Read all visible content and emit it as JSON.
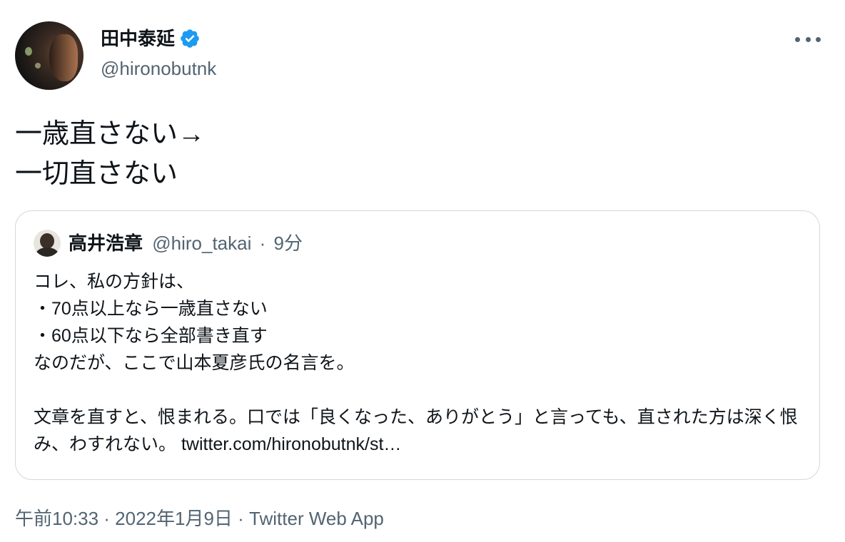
{
  "author": {
    "name": "田中泰延",
    "handle": "@hironobutnk",
    "verified_icon": "verified-badge-icon",
    "accent_color": "#1d9bf0"
  },
  "tweet": {
    "text": "一歳直さない→\n一切直さない"
  },
  "quoted_tweet": {
    "name": "高井浩章",
    "handle": "@hiro_takai",
    "separator": "·",
    "time": "9分",
    "text": "コレ、私の方針は、\n・70点以上なら一歳直さない\n・60点以下なら全部書き直す\nなのだが、ここで山本夏彦氏の名言を。\n\n文章を直すと、恨まれる。口では「良くなった、ありがとう」と言っても、直された方は深く恨み、わすれない。 twitter.com/hironobutnk/st…"
  },
  "meta": {
    "timestamp": "午前10:33 · 2022年1月9日 · Twitter Web App"
  },
  "menu": {
    "icon": "more-options-icon"
  }
}
